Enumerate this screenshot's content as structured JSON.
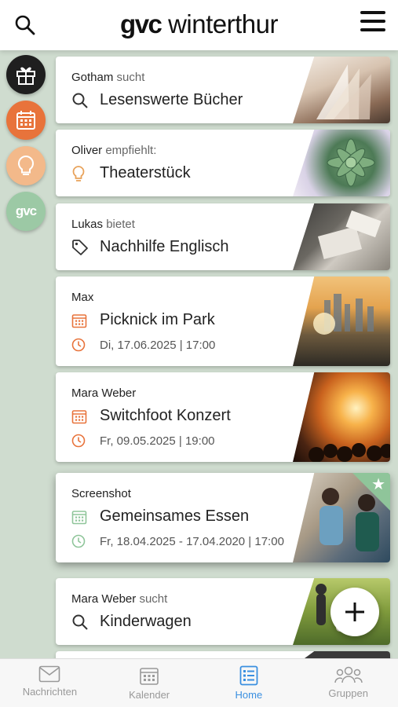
{
  "header": {
    "logo_brand": "gvc",
    "logo_city": "winterthur"
  },
  "colors": {
    "accent_orange": "#e8733b",
    "accent_green": "#8fc59a",
    "active_blue": "#3a8fe0",
    "background": "#cfdccf"
  },
  "rail": {
    "gvc_label": "gvc"
  },
  "cards": [
    {
      "who": "Gotham",
      "action": "sucht",
      "title": "Lesenswerte Bücher",
      "icon": "search-icon"
    },
    {
      "who": "Oliver",
      "action": "empfiehlt:",
      "title": "Theaterstück",
      "icon": "lightbulb-icon"
    },
    {
      "who": "Lukas",
      "action": "bietet",
      "title": "Nachhilfe Englisch",
      "icon": "tag-icon"
    },
    {
      "who": "Max",
      "action": "",
      "title": "Picknick im Park",
      "date": "Di, 17.06.2025 | 17:00",
      "icon": "calendar-icon"
    },
    {
      "who": "Mara Weber",
      "action": "",
      "title": "Switchfoot Konzert",
      "date": "Fr, 09.05.2025 | 19:00",
      "icon": "calendar-icon"
    },
    {
      "who": "Screenshot",
      "action": "",
      "title": "Gemeinsames Essen",
      "date": "Fr, 18.04.2025 - 17.04.2020 | 17:00",
      "icon": "calendar-icon"
    },
    {
      "who": "Mara Weber",
      "action": "sucht",
      "title": "Kinderwagen",
      "icon": "search-icon"
    }
  ],
  "nav": [
    {
      "label": "Nachrichten",
      "icon": "envelope-icon"
    },
    {
      "label": "Kalender",
      "icon": "calendar-icon"
    },
    {
      "label": "Home",
      "icon": "list-icon",
      "active": true
    },
    {
      "label": "Gruppen",
      "icon": "group-icon"
    }
  ]
}
